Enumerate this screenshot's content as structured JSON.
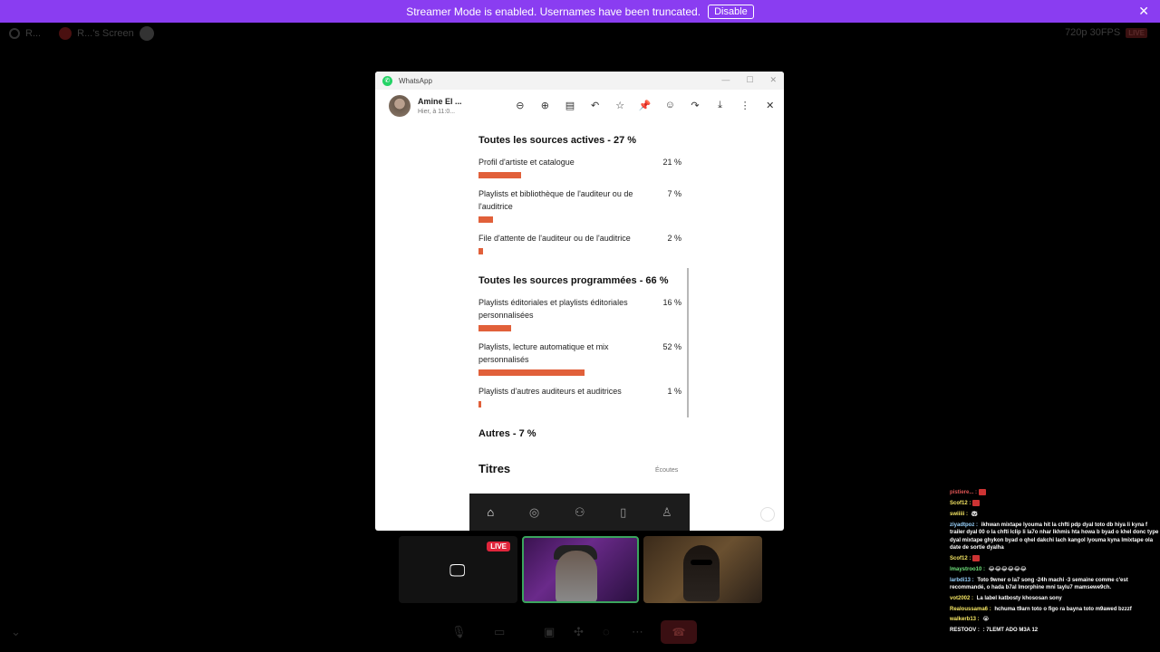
{
  "banner": {
    "message": "Streamer Mode is enabled. Usernames have been truncated.",
    "disable_label": "Disable",
    "close_glyph": "✕"
  },
  "topbar": {
    "left_label": "R...",
    "screen_label": "R...'s Screen",
    "quality": "720p 30FPS",
    "live": "LIVE"
  },
  "whatsapp": {
    "app_title": "WhatsApp",
    "window_controls": [
      "—",
      "☐",
      "✕"
    ],
    "contact_name": "Amine El ...",
    "timestamp": "Hier, à 11:0...",
    "tools": [
      "zoom-out-icon",
      "zoom-in-icon",
      "message-icon",
      "reply-icon",
      "star-icon",
      "pin-icon",
      "emoji-icon",
      "forward-icon",
      "download-icon",
      "more-icon",
      "close-icon"
    ],
    "tool_glyphs": [
      "⊖",
      "⊕",
      "▤",
      "↶",
      "☆",
      "📌",
      "☺",
      "↷",
      "⤓",
      "⋮",
      "✕"
    ]
  },
  "stats": {
    "active_title": "Toutes les sources actives - 27 %",
    "active_rows": [
      {
        "label": "Profil d'artiste et catalogue",
        "pct": "21 %",
        "value": 21
      },
      {
        "label": "Playlists et bibliothèque de l'auditeur ou de l'auditrice",
        "pct": "7 %",
        "value": 7
      },
      {
        "label": "File d'attente de l'auditeur ou de l'auditrice",
        "pct": "2 %",
        "value": 2
      }
    ],
    "programmed_title": "Toutes les sources programmées - 66 %",
    "programmed_rows": [
      {
        "label": "Playlists éditoriales et playlists éditoriales personnalisées",
        "pct": "16 %",
        "value": 16
      },
      {
        "label": "Playlists, lecture automatique et mix personnalisés",
        "pct": "52 %",
        "value": 52
      },
      {
        "label": "Playlists d'autres auditeurs et auditrices",
        "pct": "1 %",
        "value": 1
      }
    ],
    "other_title": "Autres - 7 %",
    "titres": "Titres",
    "ecoutes": "Écoutes",
    "bar_color": "#e1603a"
  },
  "tiles": {
    "live_badge": "LIVE"
  },
  "chat": [
    {
      "user": "pistiere...",
      "text": "",
      "color": "#e05555",
      "emote": true
    },
    {
      "user": "Scof12",
      "text": "",
      "color": "#f5e663",
      "emote": true
    },
    {
      "user": "swiiiii",
      "text": "🐼",
      "color": "#f5e663",
      "emote": false
    },
    {
      "user": "ziyadtpoz",
      "text": "ikhwan mixtape lyouma hit la chfti pdp dyal toto db hiya li kyna f trailer dyal 00 o la chfti lclip li la7o nhar lkhmis hta howa b byad o khel donc type dyal mixtape ghykon byad o qhel dakchi lach kangol lyouma kyna lmixtape ola date de sortie dyalha",
      "color": "#9ad4ff",
      "emote": false
    },
    {
      "user": "Scof12",
      "text": "",
      "color": "#f5e663",
      "emote": true
    },
    {
      "user": "lmaystroo10",
      "text": "😂😂😂😂😂😂",
      "color": "#6ee07a",
      "emote": false
    },
    {
      "user": "larbdi13",
      "text": "Toto 9wner o la7 song -24h machi -3 semaine comme c'est recommandé, o hada b7al lmorphine mni taylu7 mamsewe9ch.",
      "color": "#9ad4ff",
      "emote": false
    },
    {
      "user": "vot2002",
      "text": "La label katbosty khososan sony",
      "color": "#f5e663",
      "emote": false
    },
    {
      "user": "Realoussama6",
      "text": "hchuma t9arn toto o figo ra bayna toto m9awed bzzzf",
      "color": "#f5e663",
      "emote": false
    },
    {
      "user": "walkerb13",
      "text": "😭",
      "color": "#f5e663",
      "emote": false
    },
    {
      "user": "RESTOOV",
      "text": ": 7LEMT ADO M3A 12",
      "color": "#ffffff",
      "emote": false
    }
  ]
}
